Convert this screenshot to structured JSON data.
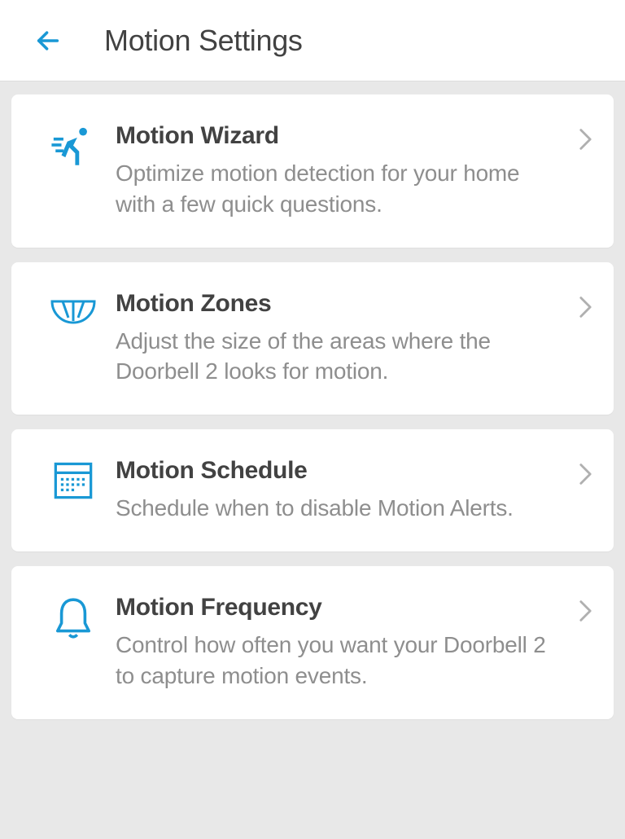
{
  "header": {
    "title": "Motion Settings"
  },
  "items": [
    {
      "icon": "running-person-icon",
      "title": "Motion Wizard",
      "description": "Optimize motion detection for your home with a few quick questions."
    },
    {
      "icon": "zones-icon",
      "title": "Motion Zones",
      "description": "Adjust the size of the areas where the Doorbell 2 looks for motion."
    },
    {
      "icon": "calendar-icon",
      "title": "Motion Schedule",
      "description": "Schedule when to disable Motion Alerts."
    },
    {
      "icon": "bell-icon",
      "title": "Motion Frequency",
      "description": "Control how often you want your Doorbell 2 to capture motion events."
    }
  ]
}
